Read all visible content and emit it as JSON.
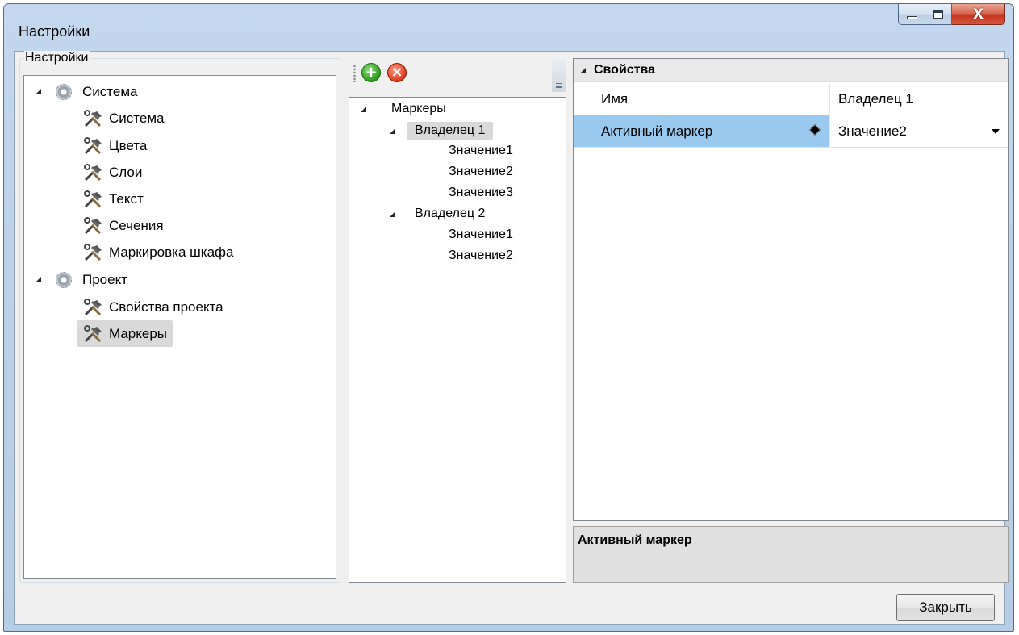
{
  "window": {
    "title": "Настройки",
    "controls": {
      "minimize_icon": "minimize-icon",
      "maximize_icon": "maximize-icon",
      "close_icon": "close-icon",
      "close_glyph": "X"
    }
  },
  "settings_group": {
    "label": "Настройки",
    "tree": [
      {
        "label": "Система",
        "level": 0,
        "icon": "gear-icon",
        "expanded": true
      },
      {
        "label": "Система",
        "level": 1,
        "icon": "tools-icon"
      },
      {
        "label": "Цвета",
        "level": 1,
        "icon": "tools-icon"
      },
      {
        "label": "Слои",
        "level": 1,
        "icon": "tools-icon"
      },
      {
        "label": "Текст",
        "level": 1,
        "icon": "tools-icon"
      },
      {
        "label": "Сечения",
        "level": 1,
        "icon": "tools-icon"
      },
      {
        "label": "Маркировка шкафа",
        "level": 1,
        "icon": "tools-icon"
      },
      {
        "label": "Проект",
        "level": 0,
        "icon": "gear-icon",
        "expanded": true
      },
      {
        "label": "Свойства проекта",
        "level": 1,
        "icon": "tools-icon"
      },
      {
        "label": "Маркеры",
        "level": 1,
        "icon": "tools-icon",
        "selected": true
      }
    ]
  },
  "markers_pane": {
    "toolbar": {
      "add_icon": "add-icon",
      "delete_icon": "delete-icon",
      "add_glyph": "+",
      "delete_glyph": "×"
    },
    "tree": [
      {
        "label": "Маркеры",
        "level": 0,
        "expanded": true
      },
      {
        "label": "Владелец 1",
        "level": 1,
        "expanded": true,
        "selected": true
      },
      {
        "label": "Значение1",
        "level": 2
      },
      {
        "label": "Значение2",
        "level": 2
      },
      {
        "label": "Значение3",
        "level": 2
      },
      {
        "label": "Владелец 2",
        "level": 1,
        "expanded": true
      },
      {
        "label": "Значение1",
        "level": 2
      },
      {
        "label": "Значение2",
        "level": 2
      }
    ]
  },
  "property_grid": {
    "category": "Свойства",
    "rows": [
      {
        "name": "Имя",
        "value": "Владелец 1"
      },
      {
        "name": "Активный маркер",
        "value": "Значение2",
        "selected": true
      }
    ],
    "description_title": "Активный маркер"
  },
  "footer": {
    "close_label": "Закрыть"
  },
  "colors": {
    "selection": "#99c9ef",
    "tree_selection": "#d9d9d9",
    "client_bg": "#f0f0f0"
  }
}
